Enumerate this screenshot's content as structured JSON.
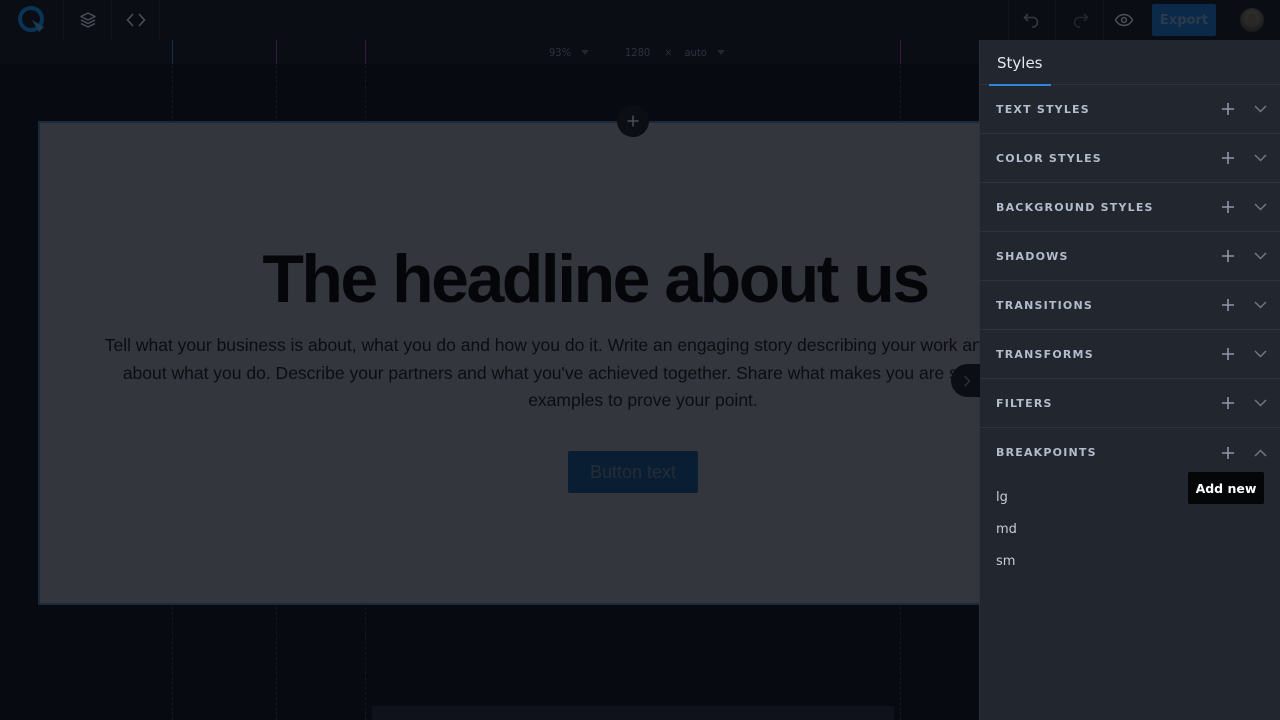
{
  "topbar": {
    "logo_icon": "q-logo-icon",
    "layers_icon": "layers-icon",
    "code_icon": "code-icon",
    "undo_icon": "undo-icon",
    "redo_icon": "redo-icon",
    "preview_icon": "eye-icon",
    "export_label": "Export",
    "avatar_icon": "user-avatar"
  },
  "canvas": {
    "zoom_value": "93%",
    "width_value": "1280",
    "times_symbol": "×",
    "height_value": "auto",
    "headline": "The headline about us",
    "paragraph": "Tell what your business is about, what you do and how you do it. Write an engaging story describing your work and how passionate you are about what you do. Describe your partners and what you've achieved together. Share what makes you are special. Provide a couple of examples to prove your point.",
    "button_label": "Button text"
  },
  "panel": {
    "tab_label": "Styles",
    "sections": [
      {
        "title": "TEXT STYLES",
        "expanded": false
      },
      {
        "title": "COLOR STYLES",
        "expanded": false
      },
      {
        "title": "BACKGROUND STYLES",
        "expanded": false
      },
      {
        "title": "SHADOWS",
        "expanded": false
      },
      {
        "title": "TRANSITIONS",
        "expanded": false
      },
      {
        "title": "TRANSFORMS",
        "expanded": false
      },
      {
        "title": "FILTERS",
        "expanded": false
      },
      {
        "title": "BREAKPOINTS",
        "expanded": true
      }
    ],
    "breakpoints": [
      "lg",
      "md",
      "sm"
    ],
    "tooltip": "Add new"
  },
  "colors": {
    "accent": "#2f86d6",
    "panel_bg": "#22262f",
    "export_bg": "#0b2a49"
  }
}
